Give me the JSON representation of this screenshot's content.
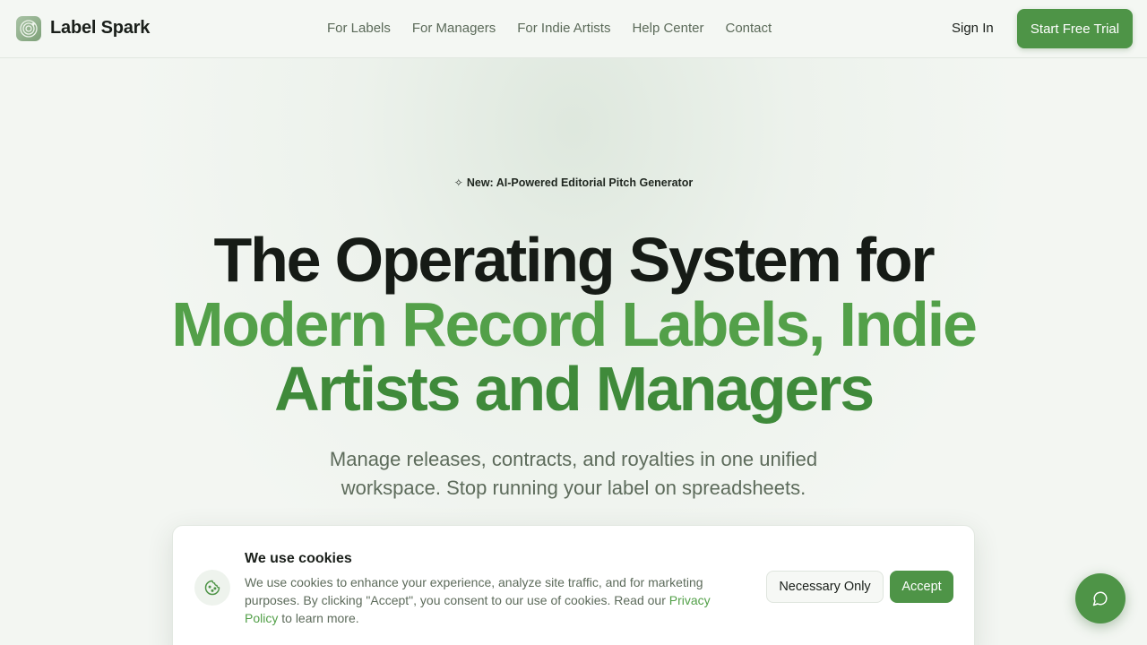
{
  "header": {
    "brand": "Label Spark",
    "nav": [
      "For Labels",
      "For Managers",
      "For Indie Artists",
      "Help Center",
      "Contact"
    ],
    "sign_in": "Sign In",
    "cta": "Start Free Trial"
  },
  "hero": {
    "badge_icon": "sparkle-icon",
    "badge": "New: AI-Powered Editorial Pitch Generator",
    "title_line1": "The Operating System for",
    "title_line2": "Modern Record Labels, Indie",
    "title_line3": "Artists and Managers",
    "subtitle": "Manage releases, contracts, and royalties in one unified workspace. Stop running your label on spreadsheets."
  },
  "cookie": {
    "icon": "cookie-icon",
    "title": "We use cookies",
    "text": "We use cookies to enhance your experience, analyze site traffic, and for marketing purposes. By clicking \"Accept\", you consent to our use of cookies. Read our",
    "link": "Privacy Policy",
    "text_end": "to learn more.",
    "necessary": "Necessary Only",
    "accept": "Accept"
  },
  "chat": {
    "icon": "chat-icon"
  },
  "colors": {
    "accent": "#4e9447",
    "accent_light": "#53a049",
    "background": "#f3f6f2"
  }
}
